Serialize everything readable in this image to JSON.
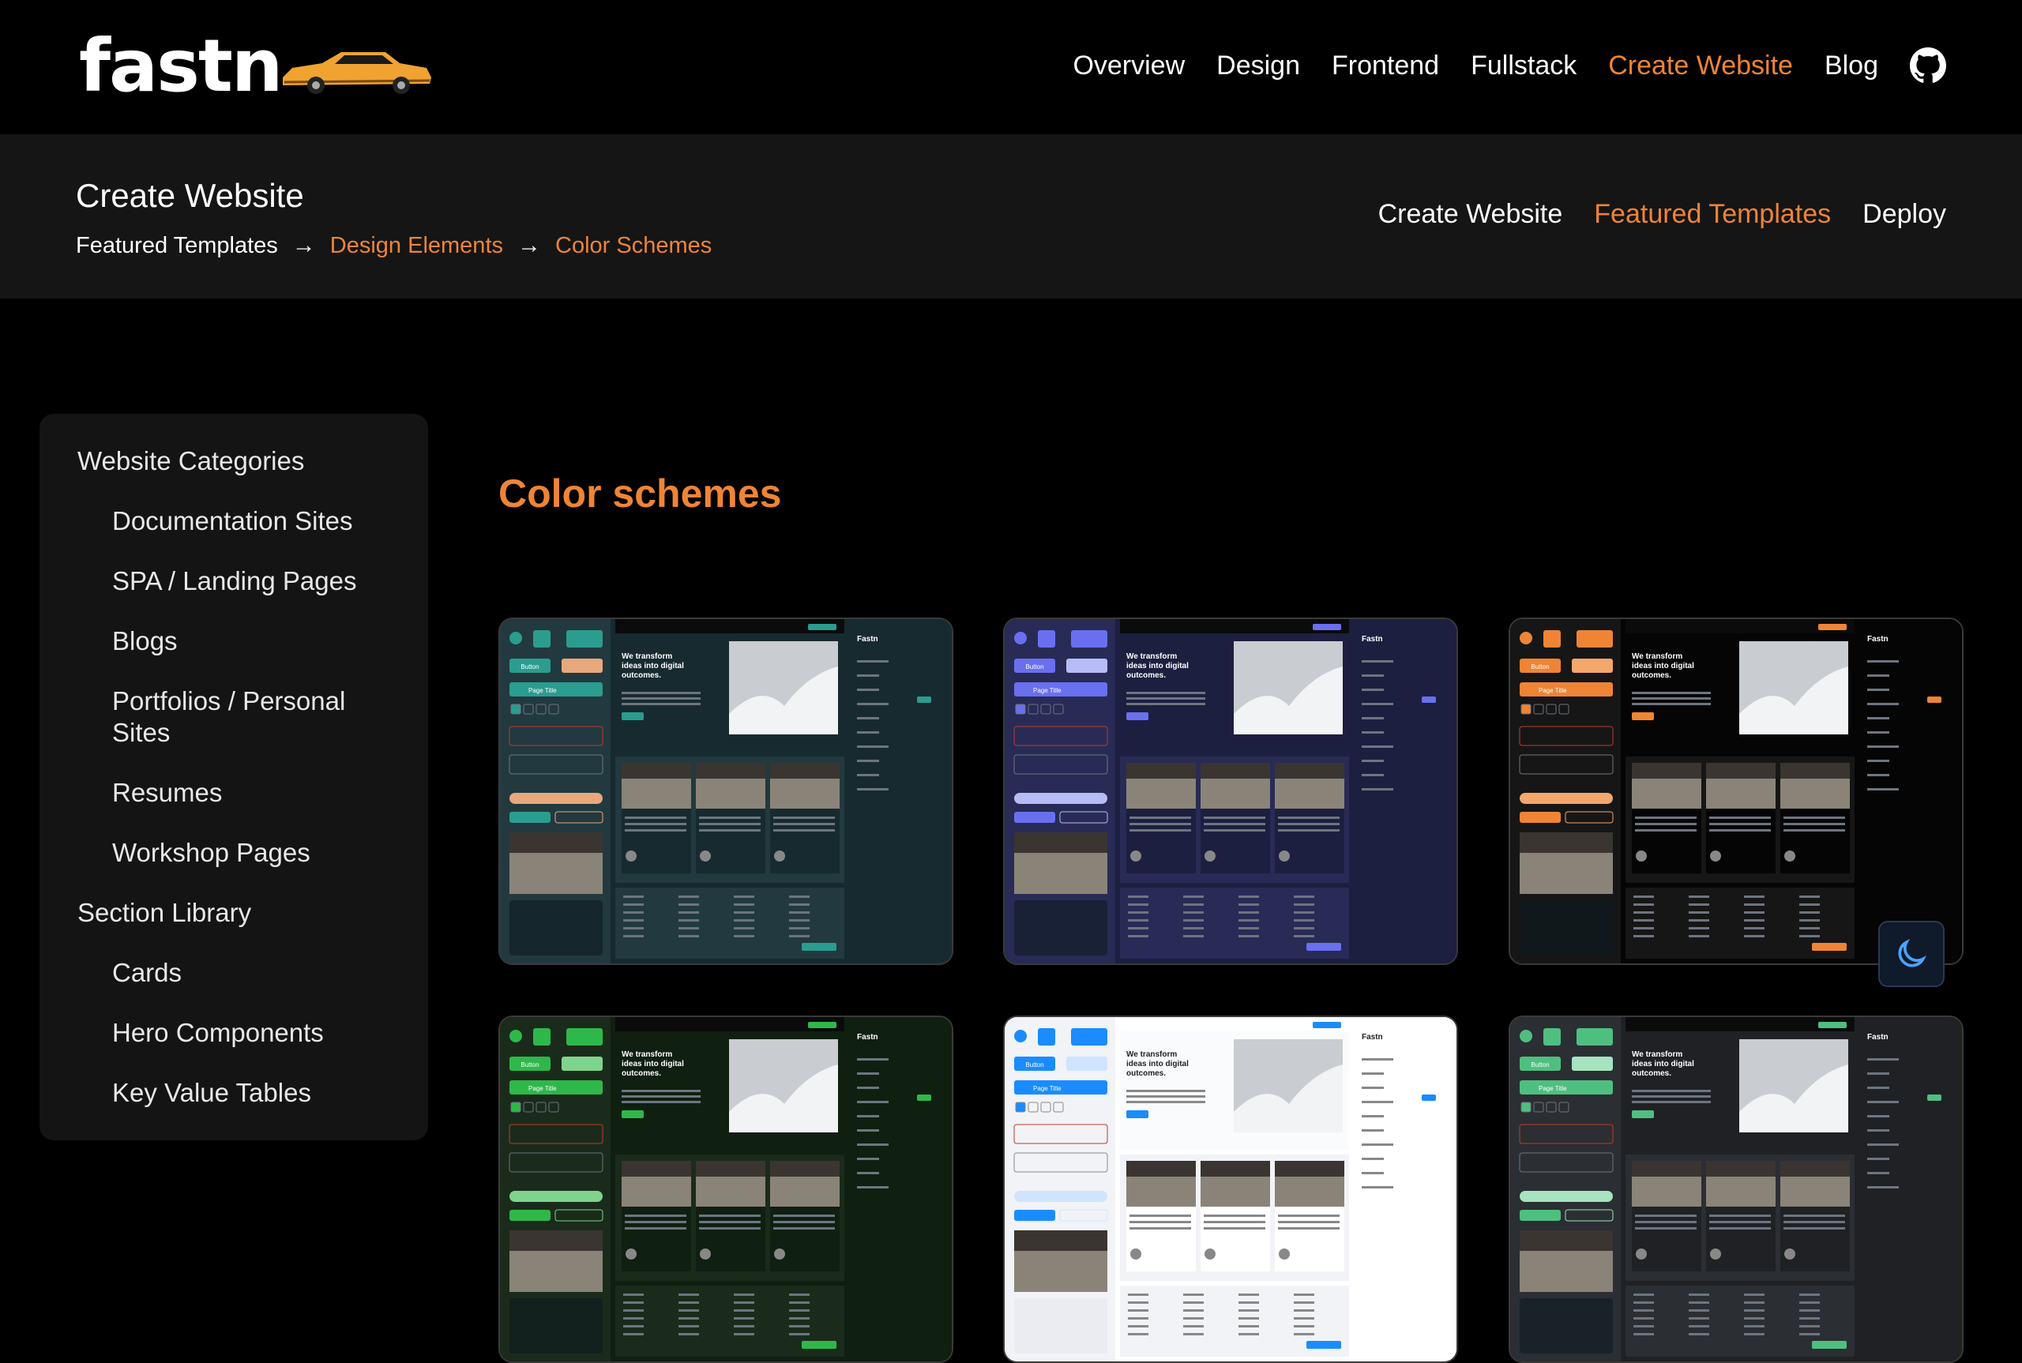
{
  "brand": {
    "name": "fastn",
    "logo_icon": "car-icon"
  },
  "nav": {
    "items": [
      {
        "label": "Overview"
      },
      {
        "label": "Design"
      },
      {
        "label": "Frontend"
      },
      {
        "label": "Fullstack"
      },
      {
        "label": "Create Website",
        "active": true
      },
      {
        "label": "Blog"
      }
    ],
    "github_icon": "github-icon",
    "accent": "#ef8435"
  },
  "subheader": {
    "title": "Create Website",
    "breadcrumbs": [
      "Featured Templates",
      "Design Elements",
      "Color Schemes"
    ],
    "tabs": [
      {
        "label": "Create Website"
      },
      {
        "label": "Featured Templates",
        "active": true
      },
      {
        "label": "Deploy"
      }
    ]
  },
  "sidebar": {
    "items": [
      {
        "label": "Website Categories",
        "level": 0
      },
      {
        "label": "Documentation Sites",
        "level": 1
      },
      {
        "label": "SPA / Landing Pages",
        "level": 1
      },
      {
        "label": "Blogs",
        "level": 1
      },
      {
        "label": "Portfolios / Personal Sites",
        "level": 1
      },
      {
        "label": "Resumes",
        "level": 1
      },
      {
        "label": "Workshop Pages",
        "level": 1
      },
      {
        "label": "Section Library",
        "level": 0
      },
      {
        "label": "Cards",
        "level": 1
      },
      {
        "label": "Hero Components",
        "level": 1
      },
      {
        "label": "Key Value Tables",
        "level": 1
      }
    ]
  },
  "main": {
    "heading": "Color schemes",
    "schemes": [
      {
        "bg": "#172a30",
        "panel": "#22393f",
        "accent": "#2a9d8f",
        "accent2": "#e8a87c"
      },
      {
        "bg": "#1c1f3f",
        "panel": "#282b55",
        "accent": "#6a6ff0",
        "accent2": "#b8bcf5"
      },
      {
        "bg": "#050505",
        "panel": "#161616",
        "accent": "#ef8435",
        "accent2": "#f4a76a"
      },
      {
        "bg": "#0f1f10",
        "panel": "#1a2b1b",
        "accent": "#2fb84a",
        "accent2": "#7fd48d"
      },
      {
        "bg": "#ffffff",
        "panel": "#f1f3f7",
        "accent": "#1a8cff",
        "accent2": "#cfe4ff"
      },
      {
        "bg": "#1f2125",
        "panel": "#2b2e33",
        "accent": "#4fbf80",
        "accent2": "#a6e3bf"
      }
    ]
  },
  "card_text": {
    "headline": "We transform ideas into digital outcomes.",
    "brand": "Fastn",
    "button": "Button",
    "page_title": "Page Title"
  },
  "theme_toggle": {
    "icon": "moon-icon"
  }
}
